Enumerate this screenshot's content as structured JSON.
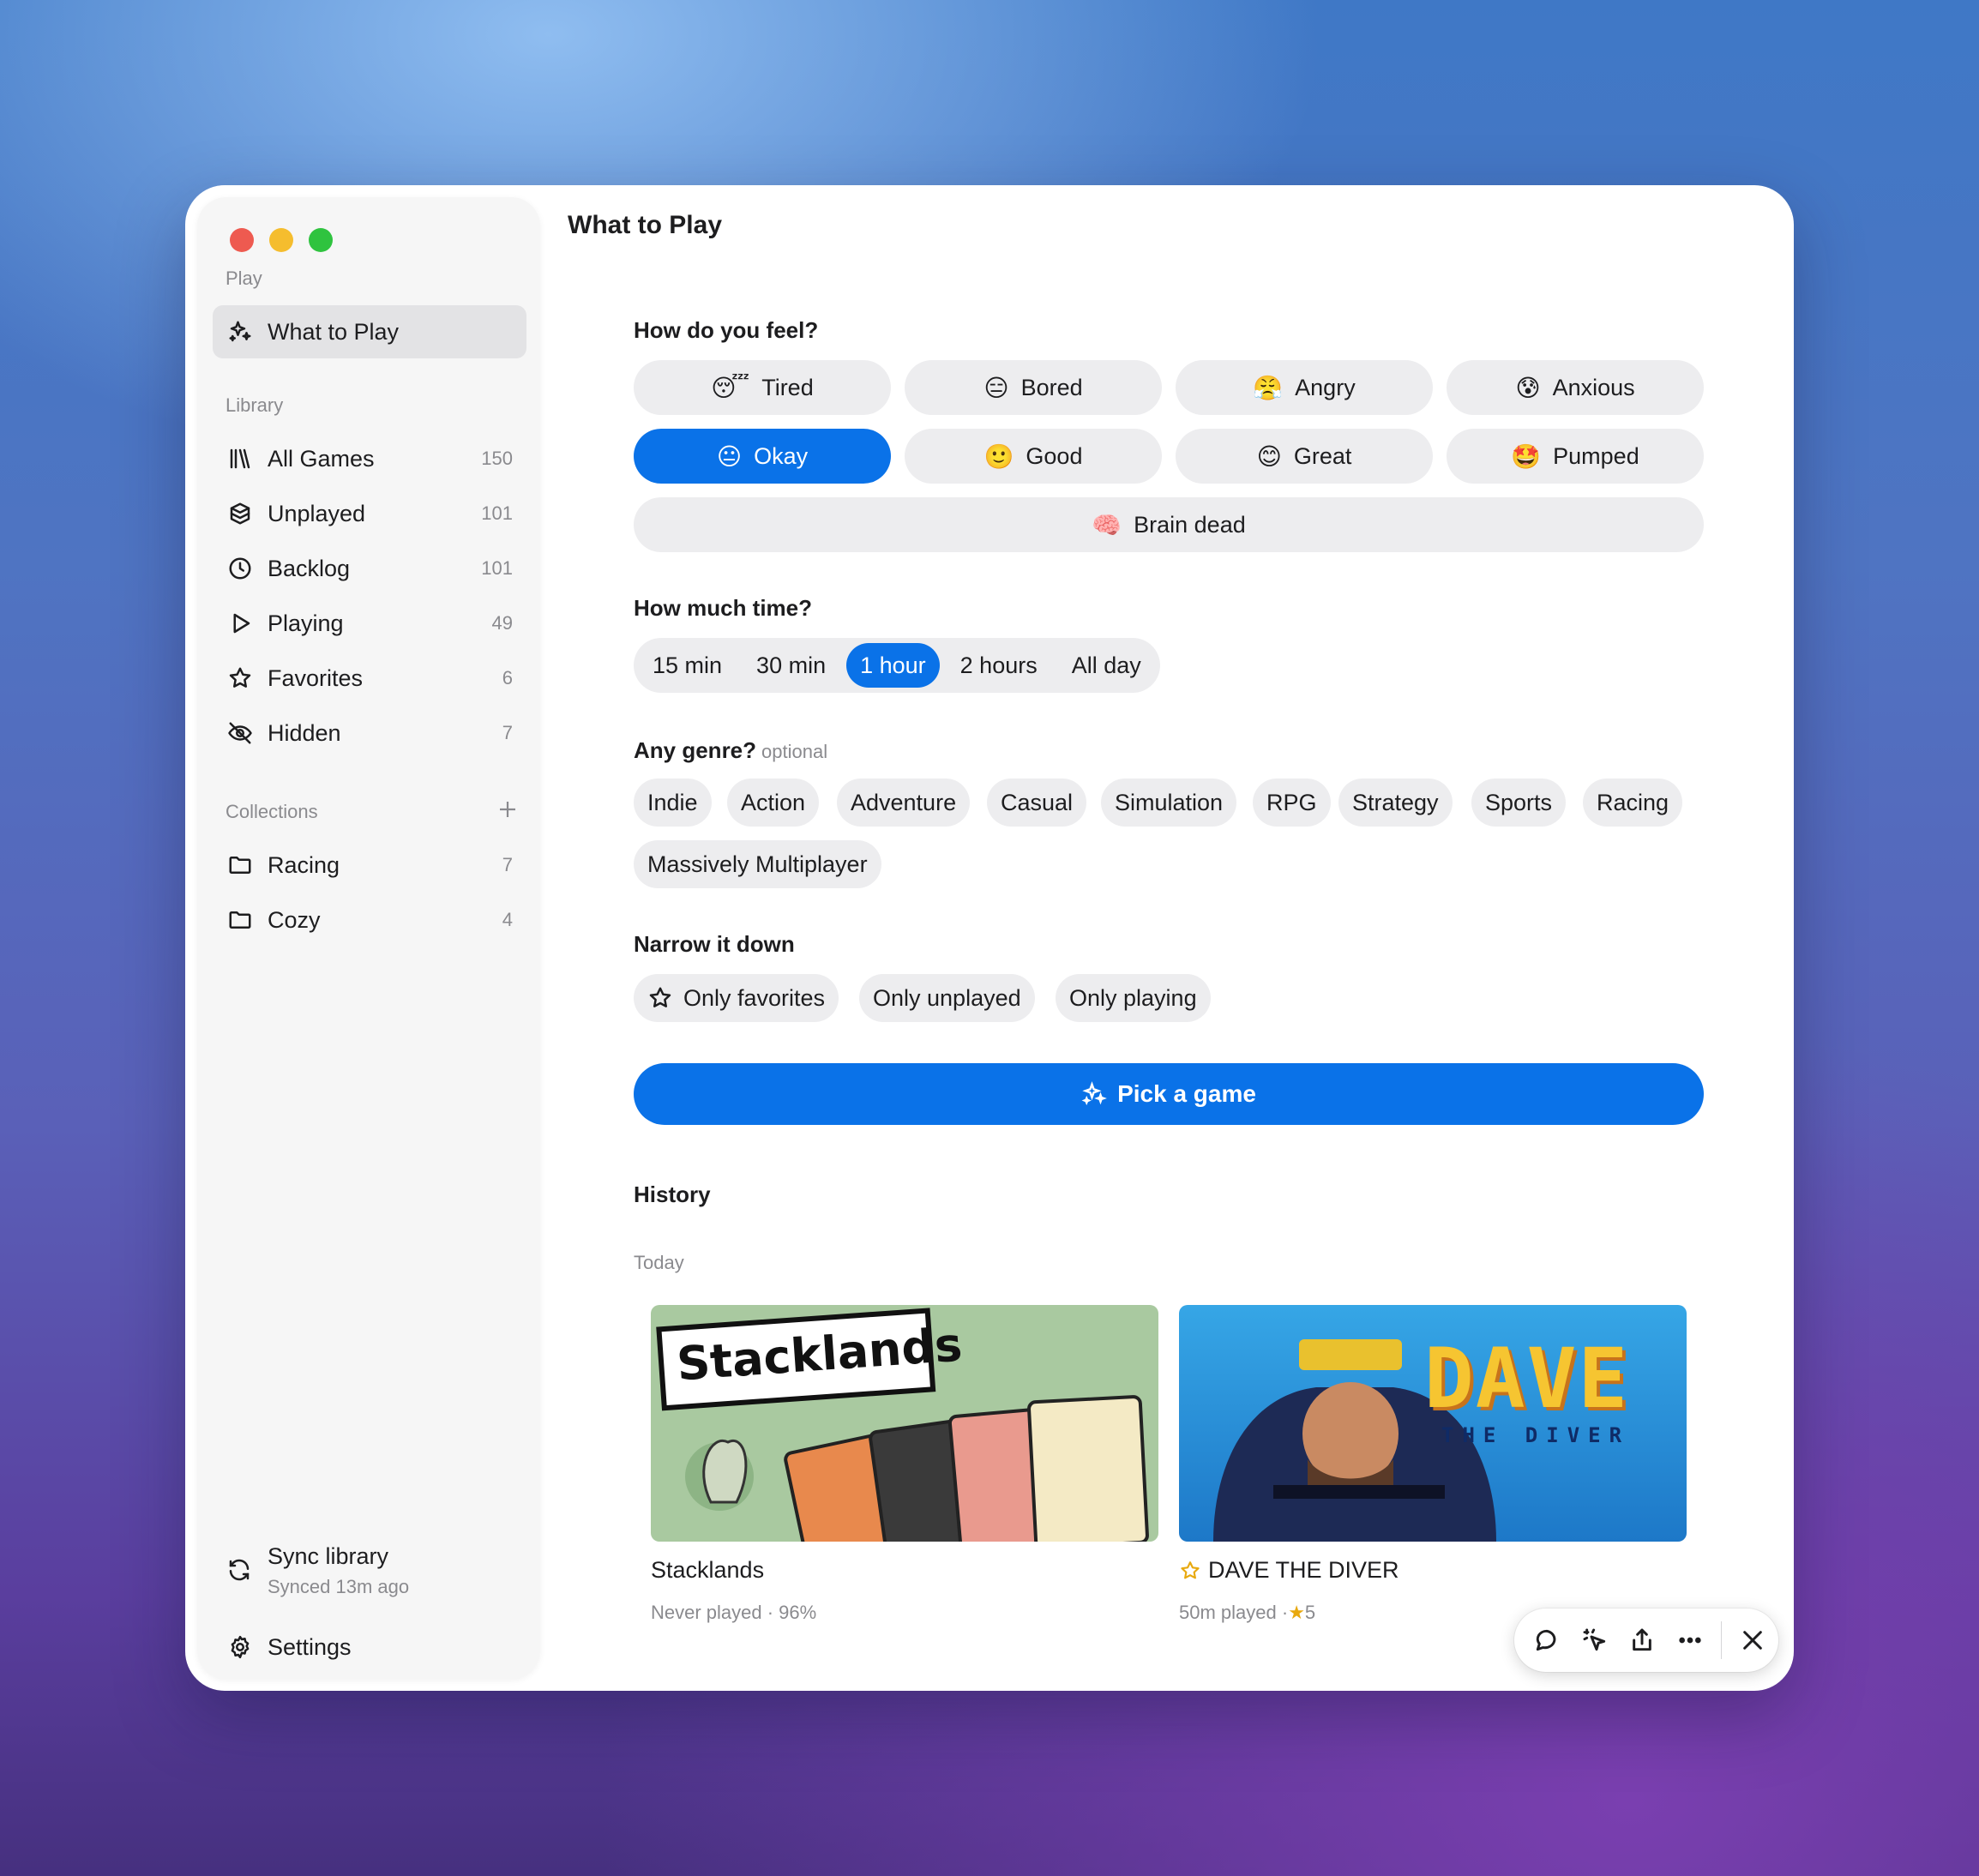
{
  "window": {
    "title": "What to Play"
  },
  "sidebar": {
    "play_label": "Play",
    "play_items": [
      {
        "label": "What to Play",
        "icon": "sparkles-icon"
      }
    ],
    "library_label": "Library",
    "library_items": [
      {
        "label": "All Games",
        "count": "150",
        "icon": "books-icon"
      },
      {
        "label": "Unplayed",
        "count": "101",
        "icon": "box-icon"
      },
      {
        "label": "Backlog",
        "count": "101",
        "icon": "clock-icon"
      },
      {
        "label": "Playing",
        "count": "49",
        "icon": "play-icon"
      },
      {
        "label": "Favorites",
        "count": "6",
        "icon": "star-icon"
      },
      {
        "label": "Hidden",
        "count": "7",
        "icon": "eye-slash-icon"
      }
    ],
    "collections_label": "Collections",
    "collections": [
      {
        "label": "Racing",
        "count": "7",
        "icon": "folder-icon"
      },
      {
        "label": "Cozy",
        "count": "4",
        "icon": "folder-icon"
      }
    ],
    "sync": {
      "title": "Sync library",
      "subtitle": "Synced 13m ago"
    },
    "settings_label": "Settings"
  },
  "main": {
    "feel_heading": "How do you feel?",
    "moods": [
      {
        "label": "Tired",
        "emoji": "😴"
      },
      {
        "label": "Bored",
        "emoji": "😑"
      },
      {
        "label": "Angry",
        "emoji": "😤"
      },
      {
        "label": "Anxious",
        "emoji": "😰"
      },
      {
        "label": "Okay",
        "emoji": "😐"
      },
      {
        "label": "Good",
        "emoji": "🙂"
      },
      {
        "label": "Great",
        "emoji": "😊"
      },
      {
        "label": "Pumped",
        "emoji": "🤩"
      },
      {
        "label": "Brain dead",
        "emoji": "🧠"
      }
    ],
    "selected_mood": "Okay",
    "time_heading": "How much time?",
    "times": [
      "15 min",
      "30 min",
      "1 hour",
      "2 hours",
      "All day"
    ],
    "selected_time": "1 hour",
    "genre_heading": "Any genre?",
    "genre_optional": "optional",
    "genres": [
      "Indie",
      "Action",
      "Adventure",
      "Casual",
      "Simulation",
      "RPG",
      "Strategy",
      "Sports",
      "Racing",
      "Massively Multiplayer"
    ],
    "narrow_heading": "Narrow it down",
    "filters": [
      "Only favorites",
      "Only unplayed",
      "Only playing"
    ],
    "pick_label": "Pick a game",
    "history_heading": "History",
    "history_day": "Today",
    "history": [
      {
        "title": "Stacklands",
        "meta": "Never played · 96%",
        "logo_text": "Stacklands",
        "favorite": false
      },
      {
        "title": "DAVE THE DIVER",
        "meta": "50m played ·",
        "rating": "5",
        "logo_text": "DAVE",
        "logo_sub": "THE DIVER",
        "favorite": true
      }
    ]
  },
  "toolbar": {
    "icons": [
      "comment-icon",
      "cursor-sparkle-icon",
      "share-icon",
      "more-icon",
      "close-icon"
    ]
  },
  "colors": {
    "accent": "#0a72e8",
    "chip": "#ededef",
    "sidebar": "#f6f6f6"
  }
}
